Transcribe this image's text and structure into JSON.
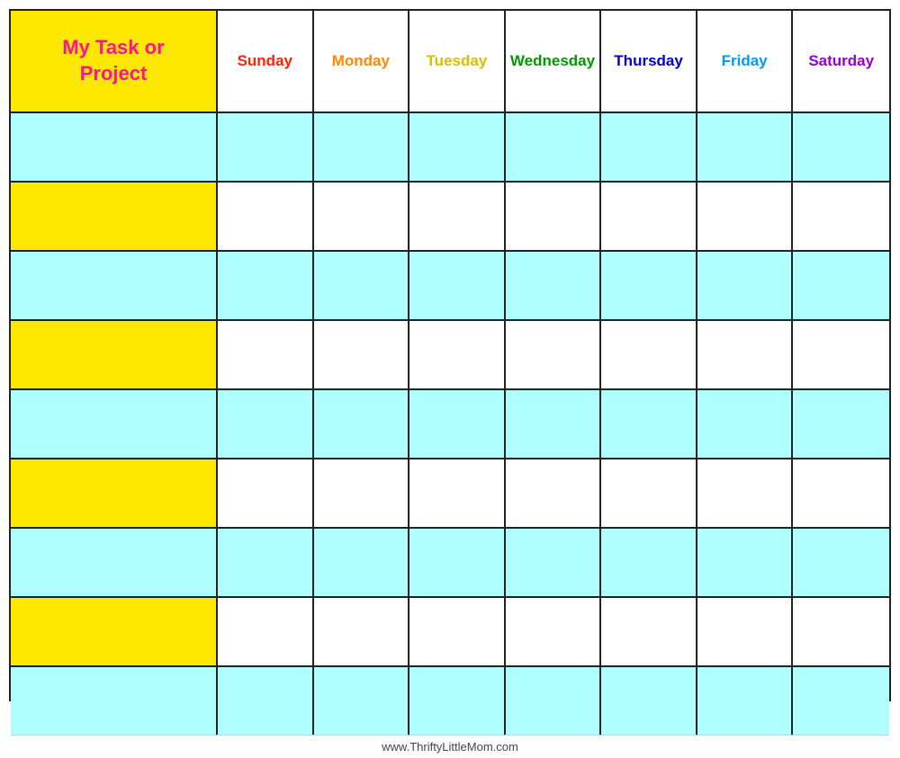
{
  "header": {
    "title_line1": "My Task or",
    "title_line2": "Project",
    "days": [
      {
        "label": "Sunday",
        "color": "#FF2200"
      },
      {
        "label": "Monday",
        "color": "#FF8800"
      },
      {
        "label": "Tuesday",
        "color": "#DDBB00"
      },
      {
        "label": "Wednesday",
        "color": "#009900"
      },
      {
        "label": "Thursday",
        "color": "#0000CC"
      },
      {
        "label": "Friday",
        "color": "#0099FF"
      },
      {
        "label": "Saturday",
        "color": "#9900CC"
      }
    ]
  },
  "rows": [
    {
      "task_color": "cyan",
      "cells": [
        "cyan",
        "cyan",
        "cyan",
        "cyan",
        "cyan",
        "cyan",
        "cyan"
      ]
    },
    {
      "task_color": "yellow",
      "cells": [
        "white",
        "white",
        "white",
        "white",
        "white",
        "white",
        "white"
      ]
    },
    {
      "task_color": "cyan",
      "cells": [
        "cyan",
        "cyan",
        "cyan",
        "cyan",
        "cyan",
        "cyan",
        "cyan"
      ]
    },
    {
      "task_color": "yellow",
      "cells": [
        "white",
        "white",
        "white",
        "white",
        "white",
        "white",
        "white"
      ]
    },
    {
      "task_color": "cyan",
      "cells": [
        "cyan",
        "cyan",
        "cyan",
        "cyan",
        "cyan",
        "cyan",
        "cyan"
      ]
    },
    {
      "task_color": "yellow",
      "cells": [
        "white",
        "white",
        "white",
        "white",
        "white",
        "white",
        "white"
      ]
    },
    {
      "task_color": "cyan",
      "cells": [
        "cyan",
        "cyan",
        "cyan",
        "cyan",
        "cyan",
        "cyan",
        "cyan"
      ]
    },
    {
      "task_color": "yellow",
      "cells": [
        "white",
        "white",
        "white",
        "white",
        "white",
        "white",
        "white"
      ]
    },
    {
      "task_color": "cyan",
      "cells": [
        "cyan",
        "cyan",
        "cyan",
        "cyan",
        "cyan",
        "cyan",
        "cyan"
      ]
    }
  ],
  "footer": {
    "url": "www.ThriftyLittleMom.com"
  }
}
